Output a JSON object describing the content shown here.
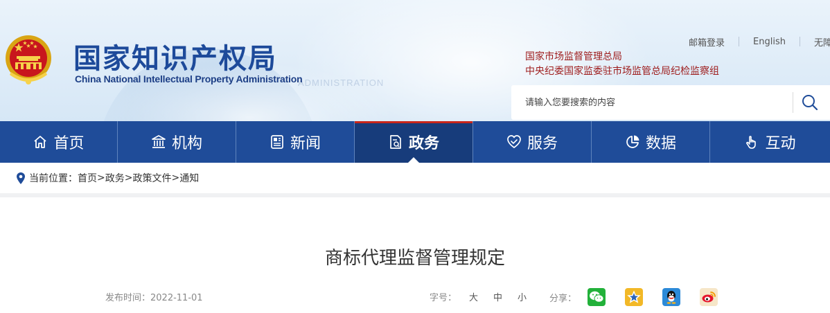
{
  "header": {
    "logo_cn": "国家知识产权局",
    "logo_en": "China National Intellectual Property Administration",
    "watermark_text": "ADMINISTRATION",
    "top_links": [
      "邮箱登录",
      "English",
      "无障碍"
    ],
    "affiliations": [
      "国家市场监督管理总局",
      "中央纪委国家监委驻市场监管总局纪检监察组"
    ],
    "search": {
      "placeholder": "请输入您要搜索的内容",
      "value": ""
    }
  },
  "nav": {
    "items": [
      {
        "label": "首页",
        "icon": "home-icon",
        "active": false
      },
      {
        "label": "机构",
        "icon": "institution-icon",
        "active": false
      },
      {
        "label": "新闻",
        "icon": "newspaper-icon",
        "active": false
      },
      {
        "label": "政务",
        "icon": "document-icon",
        "active": true
      },
      {
        "label": "服务",
        "icon": "service-heart-icon",
        "active": false
      },
      {
        "label": "数据",
        "icon": "pie-chart-icon",
        "active": false
      },
      {
        "label": "互动",
        "icon": "hand-pointer-icon",
        "active": false
      }
    ]
  },
  "breadcrumb": {
    "prefix": "当前位置：",
    "items": [
      "首页",
      "政务",
      "政策文件",
      "通知"
    ],
    "separator": ">"
  },
  "article": {
    "title": "商标代理监督管理规定",
    "publish_label": "发布时间：",
    "publish_date": "2022-11-01",
    "fontsize_label": "字号：",
    "fontsize_options": [
      "大",
      "中",
      "小"
    ],
    "share_label": "分享：",
    "share_targets": [
      "wechat-icon",
      "qzone-icon",
      "qq-icon",
      "weibo-icon"
    ]
  },
  "colors": {
    "nav_bg": "#1f4c99",
    "nav_active_bg": "#173c7b",
    "nav_active_top": "#c8261b",
    "logo_blue": "#1d4a9a",
    "affiliation_red": "#9d1b1b"
  }
}
